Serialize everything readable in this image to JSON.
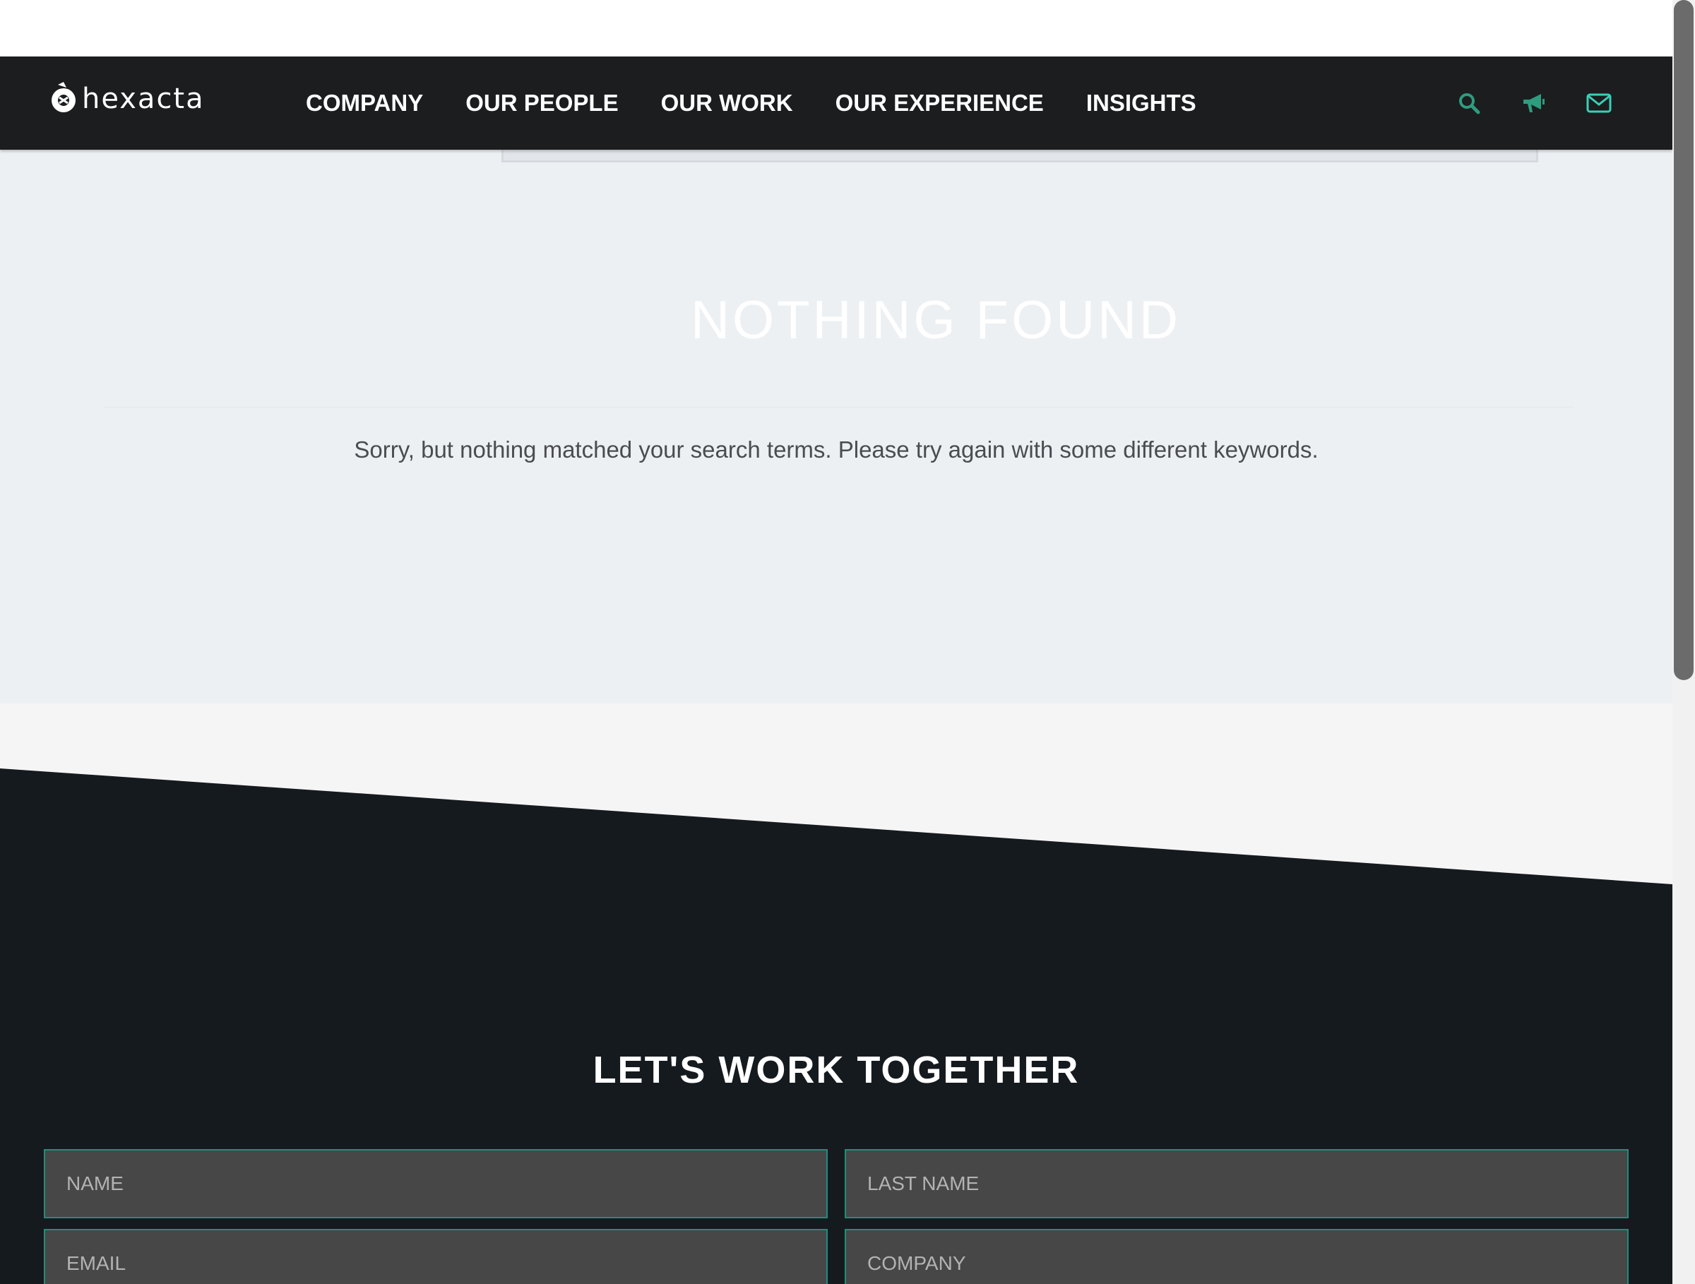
{
  "brand": {
    "logo_text": "hexacta"
  },
  "nav": {
    "items": [
      {
        "label": "COMPANY"
      },
      {
        "label": "OUR PEOPLE"
      },
      {
        "label": "OUR WORK"
      },
      {
        "label": "OUR EXPERIENCE"
      },
      {
        "label": "INSIGHTS"
      }
    ],
    "icons": [
      "search-icon",
      "megaphone-icon",
      "envelope-icon"
    ],
    "icon_colors": {
      "search": "#2e9c7f",
      "megaphone": "#2e9c7f",
      "envelope": "#38d1b8"
    }
  },
  "main": {
    "title": "NOTHING FOUND",
    "message": "Sorry, but nothing matched your search terms. Please try again with some different keywords."
  },
  "contact": {
    "title": "LET'S WORK TOGETHER",
    "fields": {
      "name_placeholder": "NAME",
      "last_name_placeholder": "LAST NAME",
      "email_placeholder": "EMAIL",
      "company_placeholder": "COMPANY"
    }
  },
  "colors": {
    "nav_bg": "#1c1d1f",
    "main_bg": "#edf0f3",
    "dark_bg": "#151a1f",
    "accent": "#1e8f7a",
    "field_bg": "#474747"
  }
}
